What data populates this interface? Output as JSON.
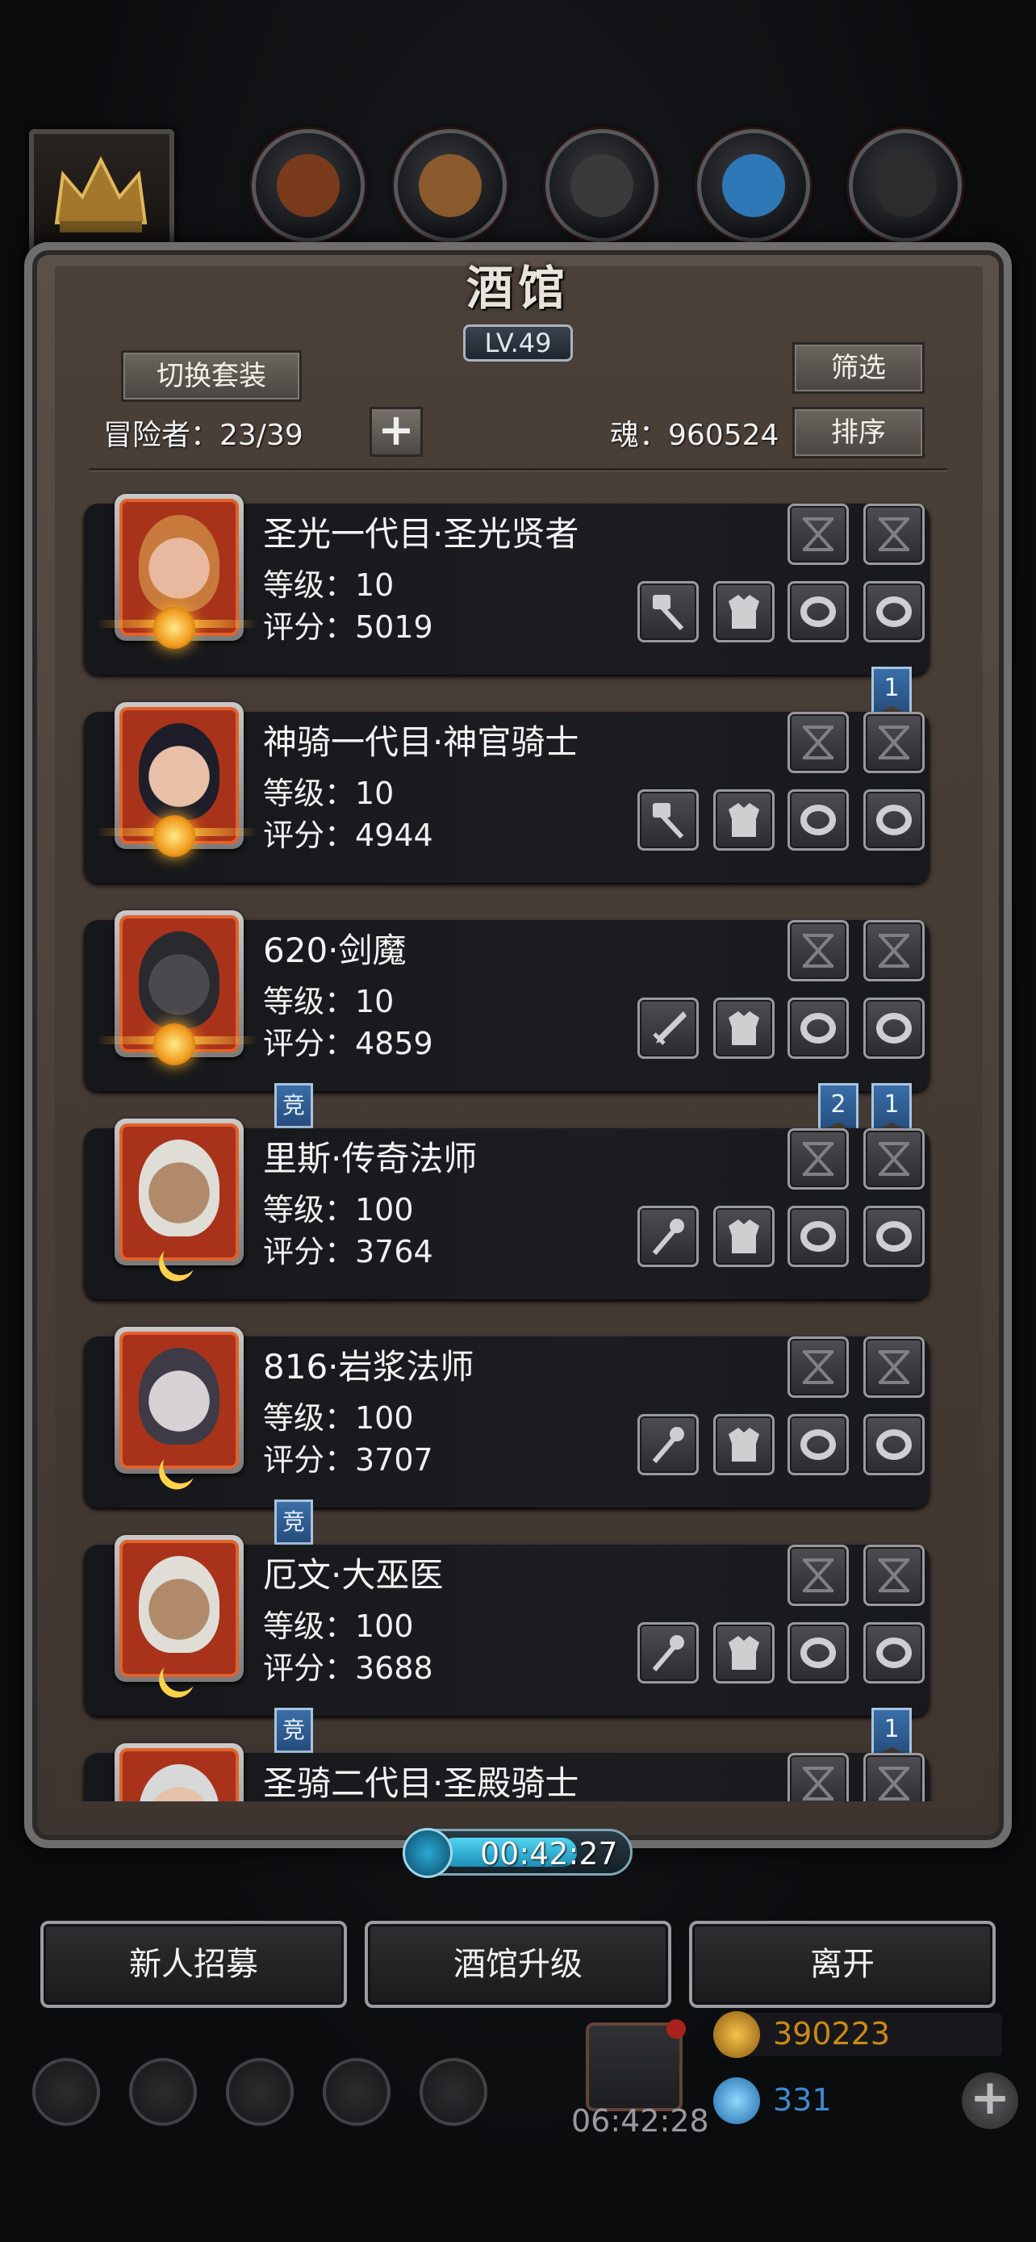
{
  "header": {
    "title": "酒馆",
    "level": "LV.49",
    "switch_set_label": "切换套装",
    "filter_label": "筛选",
    "sort_label": "排序",
    "adventurers_label": "冒险者：23/39",
    "add_label": "+",
    "soul_label": "魂：960524"
  },
  "top_slots": [
    {
      "name": "crown-icon"
    },
    {
      "name": "wood-log-icon",
      "color": "#7a3a1c"
    },
    {
      "name": "plank-icon",
      "color": "#8a5a2c"
    },
    {
      "name": "iron-ingot-icon",
      "color": "#3a3a3a"
    },
    {
      "name": "blue-crystal-icon",
      "color": "#2f78b8"
    },
    {
      "name": "stone-block-icon",
      "color": "#2c2c2c"
    }
  ],
  "heroes": [
    {
      "name": "圣光一代目·圣光贤者",
      "level": "等级：10",
      "score": "评分：5019",
      "badge": "sun",
      "face": "#e8b8a0",
      "hair": "#c87a3c",
      "weapon": "hammer-icon",
      "tags_left": [],
      "tags_right": [
        "1"
      ]
    },
    {
      "name": "神骑一代目·神官骑士",
      "level": "等级：10",
      "score": "评分：4944",
      "badge": "sun",
      "face": "#e8c0a8",
      "hair": "#1e1e2a",
      "weapon": "hammer-icon",
      "tags_left": [],
      "tags_right": []
    },
    {
      "name": "620·剑魔",
      "level": "等级：10",
      "score": "评分：4859",
      "badge": "sun",
      "face": "#4a4a4e",
      "hair": "#2a2a2e",
      "weapon": "sword-icon",
      "tags_left": [
        "竞"
      ],
      "tags_right": [
        "2",
        "1"
      ]
    },
    {
      "name": "里斯·传奇法师",
      "level": "等级：100",
      "score": "评分：3764",
      "badge": "moon",
      "face": "#b08a6a",
      "hair": "#e0ddd6",
      "weapon": "staff-icon",
      "tags_left": [],
      "tags_right": []
    },
    {
      "name": "816·岩浆法师",
      "level": "等级：100",
      "score": "评分：3707",
      "badge": "moon",
      "face": "#d8d2d6",
      "hair": "#3e3a46",
      "weapon": "staff-icon",
      "tags_left": [
        "竞"
      ],
      "tags_right": []
    },
    {
      "name": "厄文·大巫医",
      "level": "等级：100",
      "score": "评分：3688",
      "badge": "moon",
      "face": "#b08a6a",
      "hair": "#e0ddd6",
      "weapon": "staff-icon",
      "tags_left": [
        "竞"
      ],
      "tags_right": [
        "1"
      ]
    },
    {
      "name": "圣骑二代目·圣殿骑士",
      "level": "",
      "score": "",
      "badge": "sun",
      "face": "#e6c2aa",
      "hair": "#d8d8d8",
      "weapon": "hammer-icon",
      "tags_left": [],
      "tags_right": []
    }
  ],
  "timer": "00:42:27",
  "buttons": {
    "recruit": "新人招募",
    "upgrade": "酒馆升级",
    "leave": "离开"
  },
  "gift_timer": "06:42:28",
  "currency": {
    "gold": "390223",
    "gems": "331"
  },
  "colors": {
    "gold_text": "#e8a21c",
    "gem_text": "#3fa2e8"
  }
}
